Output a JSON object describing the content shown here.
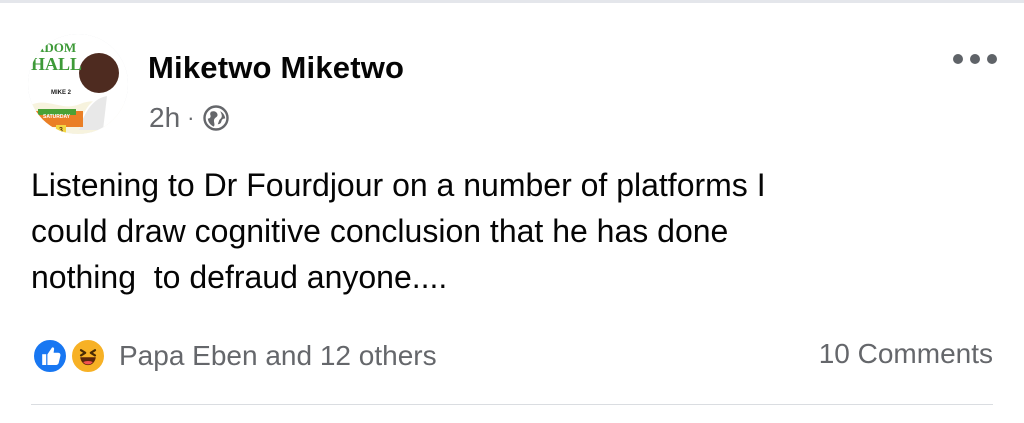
{
  "post": {
    "author": "Miketwo Miketwo",
    "time": "2h",
    "separator": "·",
    "privacy_icon": "globe-icon",
    "body": "Listening to Dr Fourdjour on a number of platforms I\ncould draw cognitive conclusion that he has done\nnothing  to defraud anyone....",
    "avatar": {
      "icon": "profile-photo-avatar",
      "poster_title": "ADOM",
      "poster_subtitle": "HALL",
      "poster_name": "MIKE 2",
      "poster_day": "SATURDAY",
      "poster_date": "3"
    }
  },
  "engagement": {
    "reaction_icons": [
      "like-reaction-icon",
      "haha-reaction-icon"
    ],
    "reaction_summary": "Papa Eben and 12 others",
    "comments": "10 Comments"
  },
  "colors": {
    "text": "#050505",
    "secondary": "#65676b",
    "like_blue": "#1877f2",
    "haha_yellow": "#f7b125",
    "divider": "#dadde1"
  }
}
